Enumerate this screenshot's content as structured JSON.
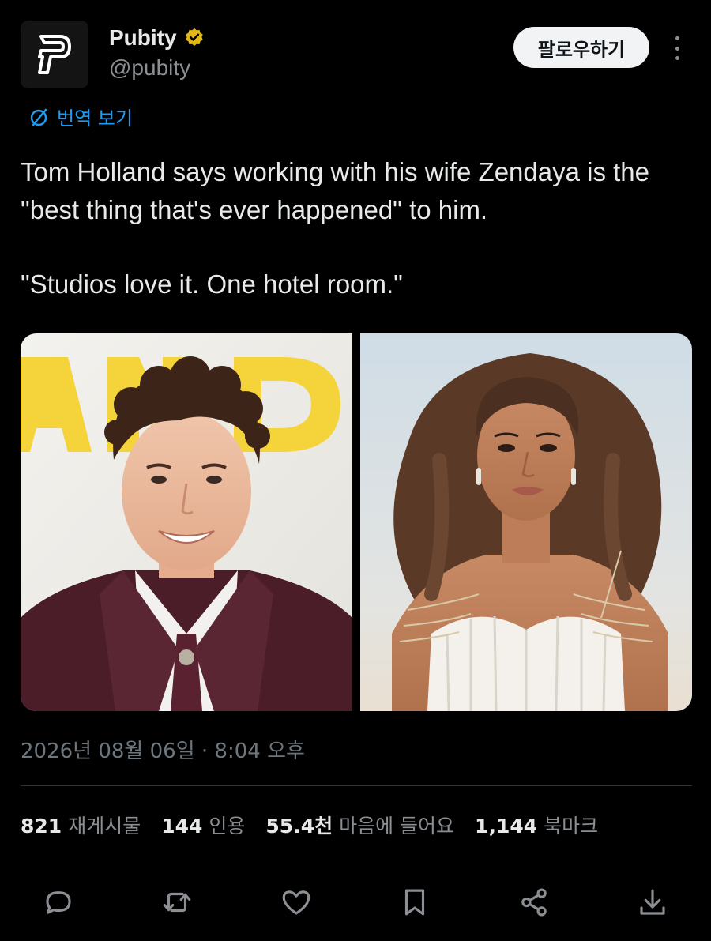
{
  "author": {
    "display_name": "Pubity",
    "handle": "@pubity",
    "verified": true,
    "verified_color": "#e2b719"
  },
  "follow_label": "팔로우하기",
  "translate_label": "번역 보기",
  "tweet": {
    "line1": "Tom Holland says working with his wife Zendaya is the \"best thing that's ever happened\" to him.",
    "line2": "\"Studios love it. One hotel room.\""
  },
  "media": [
    {
      "icon": "photo-tom-holland"
    },
    {
      "icon": "photo-zendaya"
    }
  ],
  "timestamp": "2026년 08월 06일 · 8:04 오후",
  "stats": [
    {
      "num": "821",
      "label": "재게시물"
    },
    {
      "num": "144",
      "label": "인용"
    },
    {
      "num": "55.4천",
      "label": "마음에 들어요"
    },
    {
      "num": "1,144",
      "label": "북마크"
    }
  ],
  "actions": [
    "reply-icon",
    "repost-icon",
    "like-icon",
    "bookmark-icon",
    "share-icon",
    "download-icon"
  ],
  "colors": {
    "background": "#000000",
    "link": "#1d9bf0",
    "muted": "#6e767d",
    "follow_bg": "#f2f3f4"
  }
}
